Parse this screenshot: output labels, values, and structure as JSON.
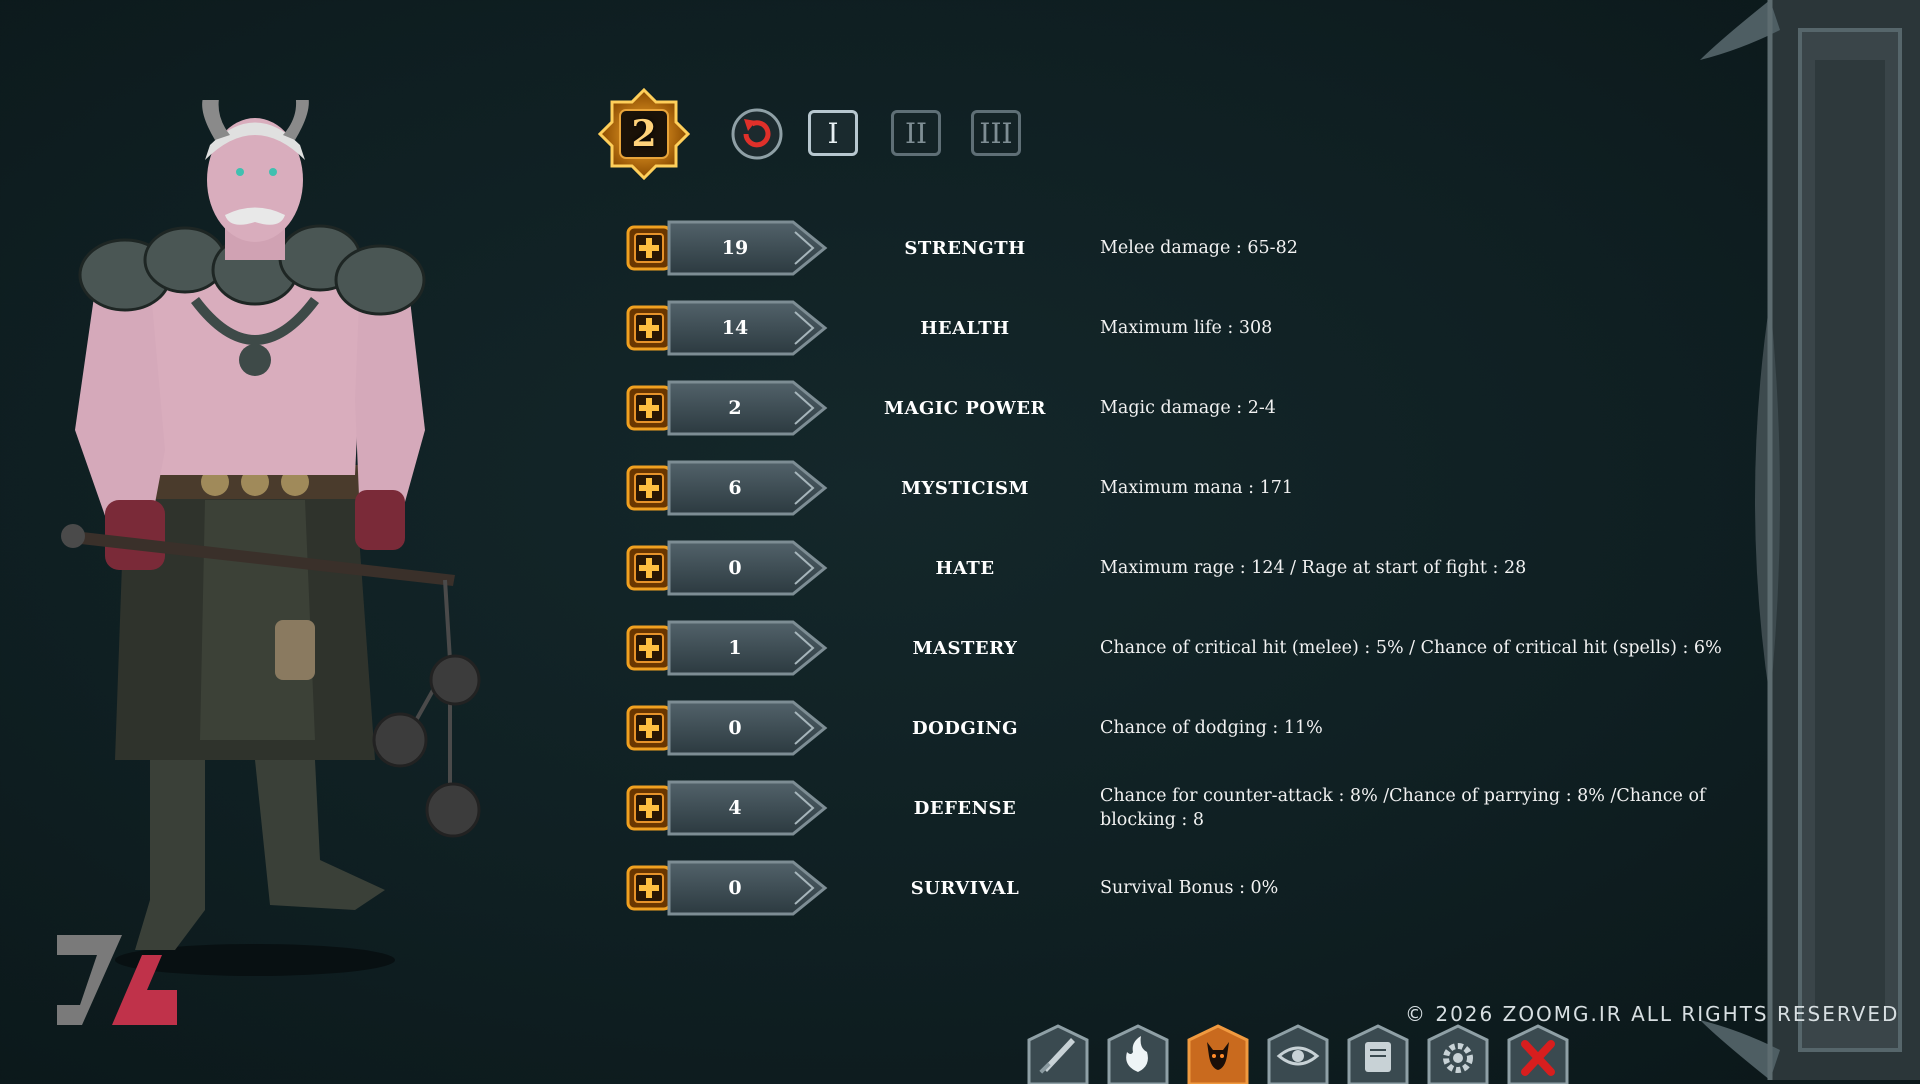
{
  "level": {
    "points": "2"
  },
  "tabs": [
    {
      "label": "I",
      "active": true
    },
    {
      "label": "II",
      "active": false
    },
    {
      "label": "III",
      "active": false
    }
  ],
  "attributes": [
    {
      "value": "19",
      "name": "STRENGTH",
      "desc": "Melee damage : 65-82"
    },
    {
      "value": "14",
      "name": "HEALTH",
      "desc": "Maximum life : 308"
    },
    {
      "value": "2",
      "name": "MAGIC POWER",
      "desc": "Magic damage : 2-4"
    },
    {
      "value": "6",
      "name": "MYSTICISM",
      "desc": "Maximum mana : 171"
    },
    {
      "value": "0",
      "name": "HATE",
      "desc": "Maximum rage : 124 / Rage at start of fight : 28"
    },
    {
      "value": "1",
      "name": "MASTERY",
      "desc": "Chance of critical hit (melee) : 5% / Chance of critical hit (spells) : 6%"
    },
    {
      "value": "0",
      "name": "DODGING",
      "desc": "Chance of dodging : 11%"
    },
    {
      "value": "4",
      "name": "DEFENSE",
      "desc": "Chance for counter-attack : 8% /Chance of parrying : 8% /Chance of blocking : 8"
    },
    {
      "value": "0",
      "name": "SURVIVAL",
      "desc": "Survival Bonus : 0%"
    }
  ],
  "copyright": "© 2026 ZOOMG.IR ALL RIGHTS RESERVED",
  "toolbar": [
    {
      "icon": "sword-icon",
      "active": false
    },
    {
      "icon": "fire-icon",
      "active": false
    },
    {
      "icon": "demon-face-icon",
      "active": true
    },
    {
      "icon": "eye-icon",
      "active": false
    },
    {
      "icon": "scroll-icon",
      "active": false
    },
    {
      "icon": "gear-icon",
      "active": false
    },
    {
      "icon": "close-icon",
      "active": false
    }
  ],
  "colors": {
    "background": "#0f1f22",
    "gold": "#f0a020",
    "plate": "#3a4a50",
    "close_red": "#d81e1e"
  }
}
